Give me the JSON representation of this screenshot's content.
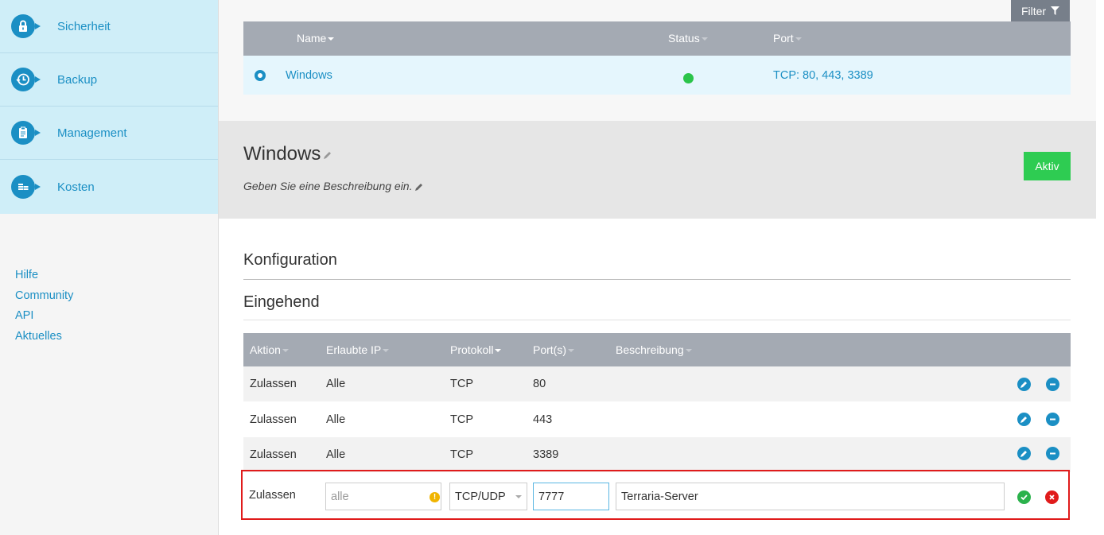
{
  "sidebar": {
    "items": [
      {
        "label": "Sicherheit",
        "icon": "lock-icon"
      },
      {
        "label": "Backup",
        "icon": "clock-icon"
      },
      {
        "label": "Management",
        "icon": "clipboard-icon"
      },
      {
        "label": "Kosten",
        "icon": "coins-icon"
      }
    ],
    "links": [
      "Hilfe",
      "Community",
      "API",
      "Aktuelles"
    ]
  },
  "server_list": {
    "filter_label": "Filter",
    "columns": {
      "name": "Name",
      "status": "Status",
      "port": "Port"
    },
    "rows": [
      {
        "name": "Windows",
        "status": "online",
        "port": "TCP: 80, 443, 3389"
      }
    ]
  },
  "detail": {
    "title": "Windows",
    "description": "Geben Sie eine Beschreibung ein.",
    "status_button": "Aktiv"
  },
  "config": {
    "section_title": "Konfiguration",
    "subsection_title": "Eingehend",
    "columns": {
      "aktion": "Aktion",
      "ip": "Erlaubte IP",
      "protokoll": "Protokoll",
      "ports": "Port(s)",
      "beschreibung": "Beschreibung"
    },
    "rules": [
      {
        "aktion": "Zulassen",
        "ip": "Alle",
        "protokoll": "TCP",
        "ports": "80",
        "beschreibung": ""
      },
      {
        "aktion": "Zulassen",
        "ip": "Alle",
        "protokoll": "TCP",
        "ports": "443",
        "beschreibung": ""
      },
      {
        "aktion": "Zulassen",
        "ip": "Alle",
        "protokoll": "TCP",
        "ports": "3389",
        "beschreibung": ""
      }
    ],
    "edit_row": {
      "aktion": "Zulassen",
      "ip_placeholder": "alle",
      "protokoll": "TCP/UDP",
      "ports": "7777",
      "beschreibung": "Terraria-Server"
    }
  },
  "colors": {
    "accent": "#1b8fc4",
    "success": "#2ecc52",
    "danger": "#e01b1b",
    "warning": "#f0b400"
  }
}
